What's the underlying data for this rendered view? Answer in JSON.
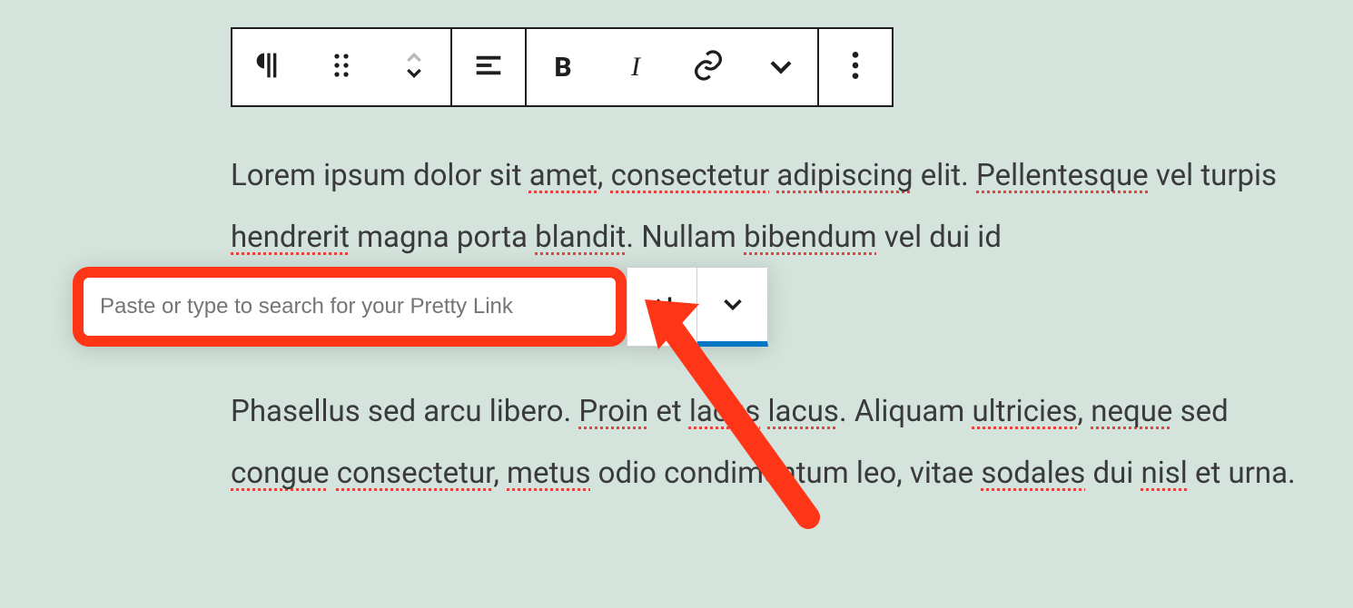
{
  "toolbar": {
    "paragraph": "paragraph",
    "drag": "drag-handle",
    "move": "move-up-down",
    "align": "align-left",
    "bold": "B",
    "italic": "I",
    "link": "link",
    "dropdown": "format-dropdown",
    "more": "more-options"
  },
  "paragraph1": {
    "t1": "Lorem ipsum dolor sit ",
    "w_amet": "amet",
    "t2": ", ",
    "w_consectetur": "consectetur",
    "t3": " ",
    "w_adipiscing": "adipiscing",
    "t4": " elit. ",
    "w_pellentesque": "Pellentesque",
    "t5": " vel turpis ",
    "w_hendrerit": "hendrerit",
    "t6": " magna porta ",
    "w_blandit": "blandit",
    "t7": ". Nullam ",
    "w_bibendum": "bibendum",
    "t8": " vel dui id"
  },
  "paragraph2": {
    "t1": "Phasellus sed arcu libero. ",
    "w_proin": "Proin",
    "t2": " et ",
    "w_lacus": "lacus",
    "t3": " ",
    "w_lacus2": "lacus",
    "t4": ". Aliquam ",
    "w_ultricies": "ultricies",
    "t5": ", ",
    "w_neque": "neque",
    "t6": " sed ",
    "w_congue": "congue",
    "t7": " ",
    "w_consectetur2": "consectetur",
    "t8": ", ",
    "w_metus": "metus",
    "t9": " odio condimentum leo, vitae ",
    "w_sodales": "sodales",
    "t10": " dui ",
    "w_nisl": "nisl",
    "t11": " et urna."
  },
  "link_popover": {
    "placeholder": "Paste or type to search for your Pretty Link",
    "value": ""
  },
  "annotation": {
    "highlight_color": "#ff3517",
    "accent_color": "#0675c4"
  }
}
